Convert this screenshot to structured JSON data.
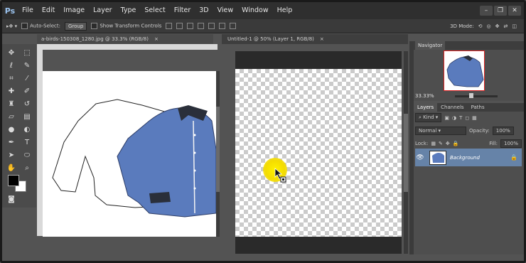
{
  "app": {
    "logo": "Ps"
  },
  "menu": [
    "File",
    "Edit",
    "Image",
    "Layer",
    "Type",
    "Select",
    "Filter",
    "3D",
    "View",
    "Window",
    "Help"
  ],
  "window_controls": [
    "–",
    "❐",
    "✕"
  ],
  "options": {
    "auto_select_label": "Auto-Select:",
    "group_value": "Group",
    "transform_label": "Show Transform Controls",
    "mode_label": "3D Mode:"
  },
  "documents": [
    {
      "title": "a-birds-150308_1280.jpg @ 33.3% (RGB/8)",
      "close": "×"
    },
    {
      "title": "Untitled-1 @ 50% (Layer 1, RGB/8)",
      "close": "×"
    }
  ],
  "navigator": {
    "tab": "Navigator",
    "zoom": "33.33%"
  },
  "layers_panel": {
    "tabs": [
      "Layers",
      "Channels",
      "Paths"
    ],
    "kind": "Kind",
    "blend_mode": "Normal",
    "opacity_label": "Opacity:",
    "opacity_value": "100%",
    "lock_label": "Lock:",
    "fill_label": "Fill:",
    "fill_value": "100%",
    "layers": [
      {
        "name": "Background",
        "visible": true,
        "locked": true
      }
    ]
  },
  "colors": {
    "accent": "#6683a8",
    "shirt": "#5a7bbd",
    "cursor_highlight": "#f4dc00",
    "nav_frame": "#dd2222"
  },
  "icons": [
    "move-tool-icon",
    "marquee-icon",
    "lasso-icon",
    "quick-select-icon",
    "crop-icon",
    "eyedropper-icon",
    "healing-brush-icon",
    "brush-icon",
    "clone-stamp-icon",
    "history-brush-icon",
    "eraser-icon",
    "gradient-icon",
    "blur-icon",
    "dodge-icon",
    "pen-icon",
    "type-icon",
    "path-select-icon",
    "shape-icon",
    "hand-icon",
    "zoom-icon",
    "eye-icon",
    "lock-icon"
  ]
}
